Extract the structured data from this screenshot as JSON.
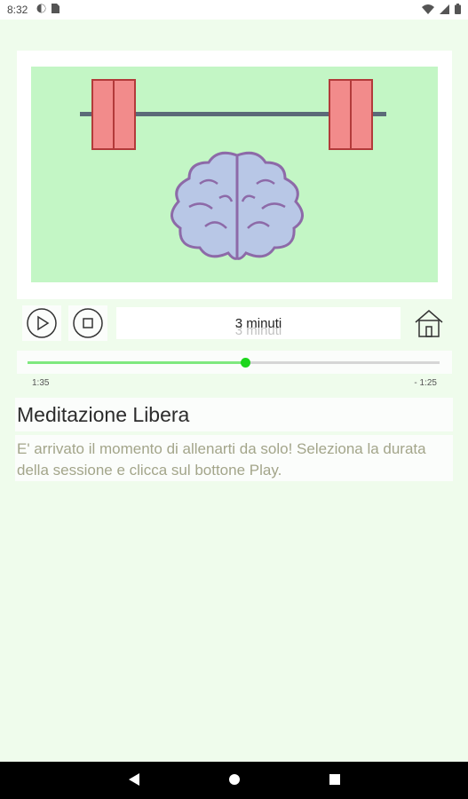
{
  "status_bar": {
    "time": "8:32"
  },
  "player": {
    "duration_label": "3 minuti",
    "elapsed": "1:35",
    "remaining": "- 1:25",
    "progress_fraction": 0.53
  },
  "content": {
    "title": "Meditazione Libera",
    "description": "E' arrivato il momento di allenarti da solo! Seleziona la durata della sessione e clicca sul bottone Play."
  },
  "colors": {
    "background": "#effcec",
    "image_bg": "#c3f6c5",
    "slider_thumb": "#1dd61d",
    "description_text": "#a3a58a"
  },
  "icons": {
    "play": "play-icon",
    "stop": "stop-icon",
    "home": "home-icon",
    "back": "nav-back-icon",
    "home_nav": "nav-home-icon",
    "recents": "nav-recents-icon"
  }
}
